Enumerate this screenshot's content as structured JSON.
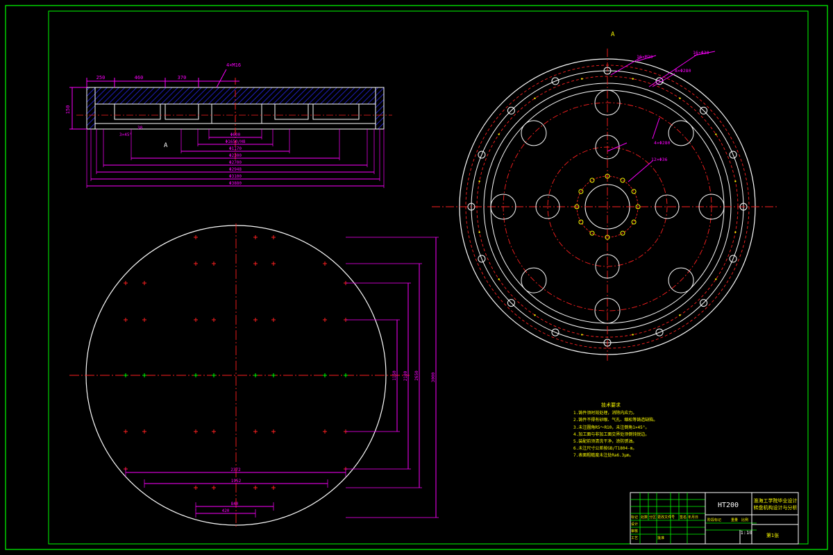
{
  "colors": {
    "background": "#000000",
    "border": "#00ff00",
    "outline": "#ffffff",
    "center_line": "#ff2020",
    "dimension": "#ff00ff",
    "hatch": "#2a2aff",
    "text": "#ffff00",
    "hole_marker": "#ffff00"
  },
  "section_view": {
    "top_dims": [
      "250",
      "460",
      "370"
    ],
    "surface_note": "4×M16",
    "height_label": "150",
    "view_label": "A",
    "small_labels": [
      "3×45°",
      "30"
    ],
    "diameter_dims": [
      "Φ600",
      "Φ1650/H8",
      "Φ1170",
      "Φ2300",
      "Φ2700",
      "Φ2948",
      "Φ3100",
      "Φ3880"
    ]
  },
  "plan_view": {
    "view_label": "A",
    "leader_notes": [
      "16×M20",
      "16×Φ30",
      "8×Φ280",
      "4×Φ280",
      "12×Φ36"
    ]
  },
  "bottom_view": {
    "vertical_dims": [
      "1150",
      "2100",
      "2650",
      "3000"
    ],
    "horizontal_dims": [
      "2372",
      "1952",
      "840",
      "420"
    ]
  },
  "tech_notes": {
    "title": "技术要求",
    "lines": [
      "1.铸件须时效处理，消除内应力。",
      "2.铸件不得有砂眼、气孔、缩松等铸造缺陷。",
      "3.未注圆角R5～R10，未注倒角1×45°。",
      "4.加工面与非加工面交界处须倒钝锐边。",
      "5.装配前须清洗干净，涂防锈油。",
      "6.未注尺寸公差按GB/T1804-m。",
      "7.表面粗糙度未注处Ra6.3μm。"
    ]
  },
  "title_block": {
    "material": "HT200",
    "school": "淮海工学院毕业设计",
    "drawing_name": "转盘机构设计与分析",
    "scale": "1:10",
    "sheet_label": "第1张",
    "labels": [
      "标记",
      "处数",
      "分区",
      "更改文件号",
      "签名",
      "年月日",
      "设计",
      "审核",
      "工艺",
      "批准",
      "阶段标记",
      "重量",
      "比例"
    ]
  }
}
